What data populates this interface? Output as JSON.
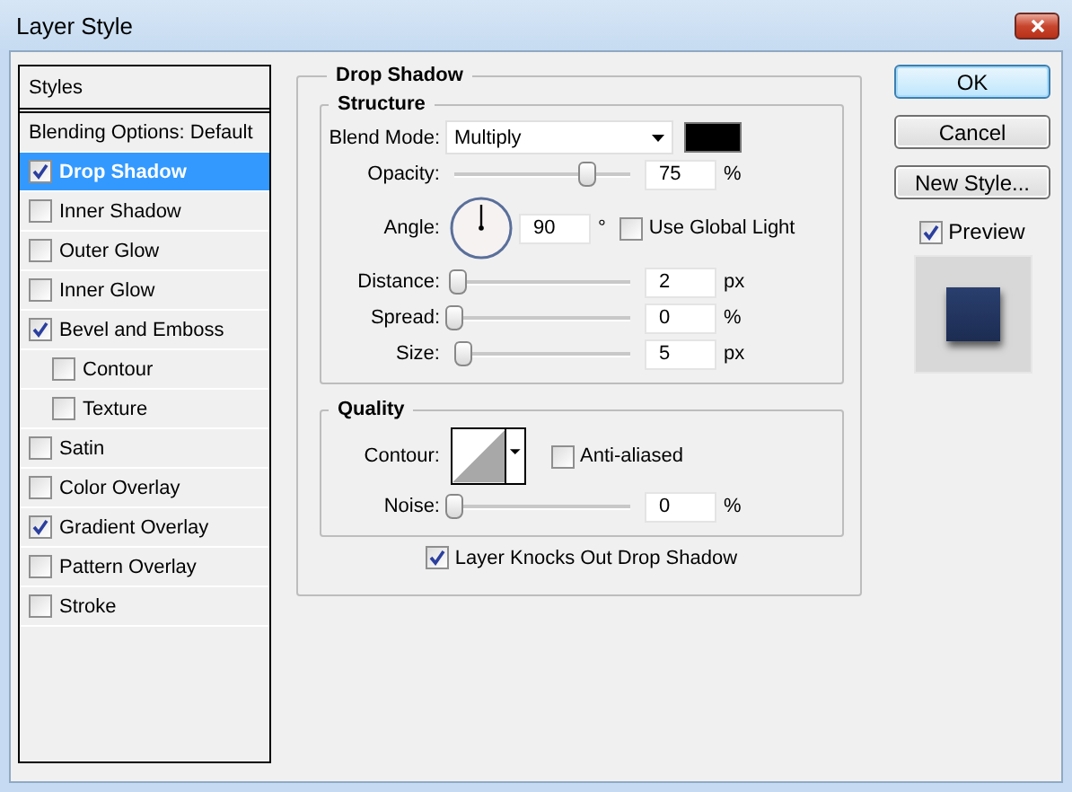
{
  "window": {
    "title": "Layer Style"
  },
  "sidebar": {
    "header": "Styles",
    "blending_options": "Blending Options: Default",
    "items": [
      {
        "label": "Drop Shadow",
        "checked": true,
        "selected": true
      },
      {
        "label": "Inner Shadow",
        "checked": false,
        "selected": false
      },
      {
        "label": "Outer Glow",
        "checked": false,
        "selected": false
      },
      {
        "label": "Inner Glow",
        "checked": false,
        "selected": false
      },
      {
        "label": "Bevel and Emboss",
        "checked": true,
        "selected": false,
        "children": [
          {
            "label": "Contour",
            "checked": false,
            "selected": false
          },
          {
            "label": "Texture",
            "checked": false,
            "selected": false
          }
        ]
      },
      {
        "label": "Satin",
        "checked": false,
        "selected": false
      },
      {
        "label": "Color Overlay",
        "checked": false,
        "selected": false
      },
      {
        "label": "Gradient Overlay",
        "checked": true,
        "selected": false
      },
      {
        "label": "Pattern Overlay",
        "checked": false,
        "selected": false
      },
      {
        "label": "Stroke",
        "checked": false,
        "selected": false
      }
    ]
  },
  "drop_shadow": {
    "title": "Drop Shadow",
    "structure": {
      "title": "Structure",
      "rows": [
        {
          "kind": "select",
          "label": "Blend Mode:",
          "value": "Multiply",
          "color": "#000000"
        },
        {
          "kind": "slider",
          "label": "Opacity:",
          "level": 0.75,
          "value": "75",
          "unit": "%"
        },
        {
          "kind": "angle",
          "label": "Angle:",
          "value": "90",
          "unit": "°",
          "option": {
            "label": "Use Global Light",
            "checked": false
          }
        },
        {
          "kind": "slider",
          "label": "Distance:",
          "level": 0.02,
          "value": "2",
          "unit": "px"
        },
        {
          "kind": "slider",
          "label": "Spread:",
          "level": 0,
          "value": "0",
          "unit": "%"
        },
        {
          "kind": "slider",
          "label": "Size:",
          "level": 0.05,
          "value": "5",
          "unit": "px"
        }
      ]
    },
    "quality": {
      "title": "Quality",
      "rows": [
        {
          "kind": "contour",
          "label": "Contour:",
          "option": {
            "label": "Anti-aliased",
            "checked": false
          }
        },
        {
          "kind": "slider",
          "label": "Noise:",
          "level": 0,
          "value": "0",
          "unit": "%"
        }
      ]
    },
    "knockout": {
      "label": "Layer Knocks Out Drop Shadow",
      "checked": true
    }
  },
  "buttons": [
    {
      "label": "OK",
      "default": true
    },
    {
      "label": "Cancel",
      "default": false
    },
    {
      "label": "New Style...",
      "default": false
    }
  ],
  "preview": {
    "label": "Preview",
    "checked": true
  }
}
